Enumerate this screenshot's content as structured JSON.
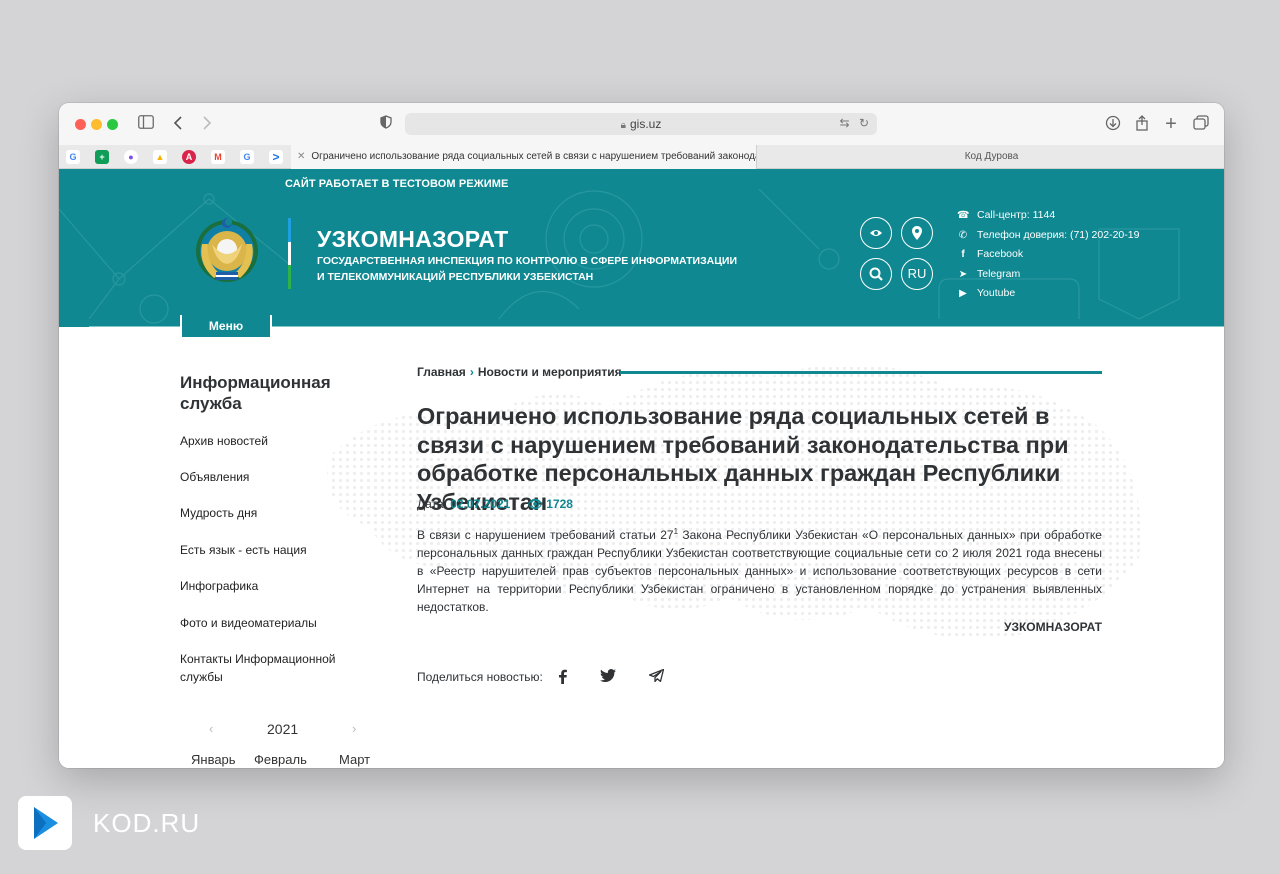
{
  "browser": {
    "url": "gis.uz",
    "active_tab_title": "Ограничено использование ряда социальных сетей в связи с нарушением требований законода...",
    "other_tab_title": "Код Дурова",
    "favicons": [
      {
        "name": "google",
        "glyph": "G",
        "color": "#4285f4"
      },
      {
        "name": "sheets",
        "glyph": "+",
        "color": "#0f9d58"
      },
      {
        "name": "podcasts",
        "glyph": "●",
        "color": "#7d4ae8"
      },
      {
        "name": "drive",
        "glyph": "▲",
        "color": "#f4b400"
      },
      {
        "name": "acrobat",
        "glyph": "A",
        "color": "#d9234b"
      },
      {
        "name": "gmail",
        "glyph": "M",
        "color": "#ea4335"
      },
      {
        "name": "google",
        "glyph": "G",
        "color": "#4285f4"
      },
      {
        "name": "kod",
        "glyph": ">",
        "color": "#1a73e8"
      }
    ]
  },
  "header": {
    "test_mode": "САЙТ РАБОТАЕТ В ТЕСТОВОМ РЕЖИМЕ",
    "org_title": "УЗКОМНАЗОРАТ",
    "org_subtitle": "ГОСУДАРСТВЕННАЯ ИНСПЕКЦИЯ ПО КОНТРОЛЮ В СФЕРЕ ИНФОРМАТИЗАЦИИ И ТЕЛЕКОММУНИКАЦИЙ РЕСПУБЛИКИ УЗБЕКИСТАН",
    "lang": "RU",
    "contacts": [
      {
        "icon": "headset-icon",
        "text": "Call-центр: 1144"
      },
      {
        "icon": "phone-icon",
        "text": "Телефон доверия: (71) 202-20-19"
      },
      {
        "icon": "facebook-icon",
        "text": "Facebook"
      },
      {
        "icon": "telegram-icon",
        "text": "Telegram"
      },
      {
        "icon": "youtube-icon",
        "text": "Youtube"
      }
    ],
    "menu_label": "Меню",
    "accent_color": "#0f8891"
  },
  "sidebar": {
    "title": "Информационная служба",
    "items": [
      "Архив новостей",
      "Объявления",
      "Мудрость дня",
      "Есть язык - есть нация",
      "Инфографика",
      "Фото и видеоматериалы",
      "Контакты Информационной службы"
    ],
    "calendar": {
      "year": "2021",
      "months": [
        "Январь",
        "Февраль",
        "Март"
      ]
    }
  },
  "article": {
    "breadcrumb": [
      "Главная",
      "Новости и мероприятия"
    ],
    "title": "Ограничено использование ряда социальных сетей в связи с нарушением требований законодательства при обработке персональных данных граждан Республики Узбекистан",
    "date_label": "Дата:",
    "date": "02.07.2021",
    "views": "1728",
    "body_part1": "В связи с нарушением требований статьи 27",
    "body_sup": "1",
    "body_part2": " Закона Республики Узбекистан «О персональных данных» при обработке персональных данных граждан Республики Узбекистан соответствующие социальные сети со 2 июля 2021 года внесены в «Реестр нарушителей прав субъектов персональных данных» и использование соответствующих ресурсов в сети Интернет на территории Республики Узбекистан ограничено в установленном порядке до устранения выявленных недостатков.",
    "signature": "УЗКОМНАЗОРАТ",
    "share_label": "Поделиться новостью:"
  },
  "watermark": {
    "brand": "KOD.RU"
  }
}
